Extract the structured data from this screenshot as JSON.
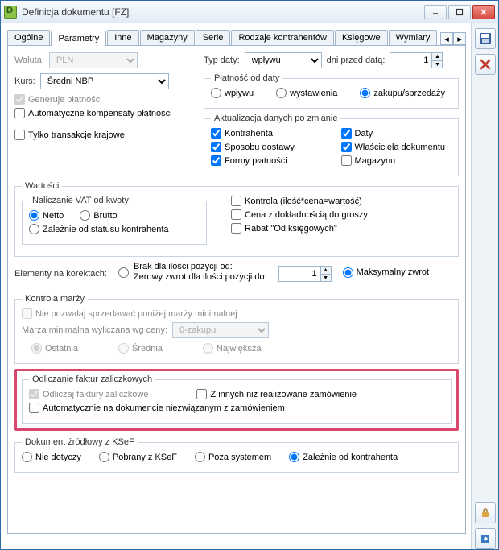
{
  "window": {
    "title": "Definicja dokumentu [FZ]"
  },
  "tabs": {
    "items": [
      {
        "label": "Ogólne"
      },
      {
        "label": "Parametry"
      },
      {
        "label": "Inne"
      },
      {
        "label": "Magazyny"
      },
      {
        "label": "Serie"
      },
      {
        "label": "Rodzaje kontrahentów"
      },
      {
        "label": "Księgowe"
      },
      {
        "label": "Wymiary"
      }
    ]
  },
  "left": {
    "waluta_label": "Waluta:",
    "waluta_value": "PLN",
    "kurs_label": "Kurs:",
    "kurs_value": "Średni NBP",
    "generuje_platnosci": "Generuje płatności",
    "auto_kompensaty": "Automatyczne kompensaty płatności",
    "tylko_krajowe": "Tylko transakcje krajowe"
  },
  "right": {
    "typ_daty_label": "Typ daty:",
    "typ_daty_value": "wpływu",
    "dni_przed_label": "dni przed datą:",
    "dni_przed_value": "1",
    "platnosc_od_daty_legend": "Płatność od daty",
    "pod_wplywu": "wpływu",
    "pod_wystawienia": "wystawienia",
    "pod_zakupu": "zakupu/sprzedaży",
    "aktualizacja_legend": "Aktualizacja danych po zmianie",
    "akt_kontrahenta": "Kontrahenta",
    "akt_daty": "Daty",
    "akt_sposobu": "Sposobu dostawy",
    "akt_wlasciciela": "Właściciela dokumentu",
    "akt_formy": "Formy płatności",
    "akt_magazynu": "Magazynu"
  },
  "wartosci": {
    "legend": "Wartości",
    "naliczanie_legend": "Naliczanie VAT od kwoty",
    "netto": "Netto",
    "brutto": "Brutto",
    "zaleznie": "Zależnie od statusu kontrahenta",
    "kontrola": "Kontrola (ilość*cena=wartość)",
    "cena_dokladnosc": "Cena z dokładnością do groszy",
    "rabat": "Rabat \"Od księgowych\""
  },
  "korekty": {
    "label": "Elementy na korektach:",
    "opt1a": "Brak dla ilości pozycji od:",
    "opt1b": "Zerowy zwrot dla ilości pozycji do:",
    "value": "1",
    "opt2": "Maksymalny zwrot"
  },
  "marza": {
    "legend": "Kontrola marży",
    "nie_pozwalaj": "Nie pozwalaj sprzedawać poniżej marży minimalnej",
    "min_label": "Marża minimalna wyliczana wg ceny:",
    "min_value": "0-zakupu",
    "ostatnia": "Ostatnia",
    "srednia": "Średnia",
    "najwieksza": "Największa"
  },
  "odliczanie": {
    "legend": "Odliczanie faktur zaliczkowych",
    "odliczaj": "Odliczaj faktury zaliczkowe",
    "zinnych": "Z innych niż realizowane zamówienie",
    "auto": "Automatycznie na dokumencie niezwiązanym z zamówieniem"
  },
  "ksef": {
    "legend": "Dokument źródłowy z KSeF",
    "nie_dotyczy": "Nie dotyczy",
    "pobrany": "Pobrany z KSeF",
    "poza": "Poza systemem",
    "zaleznie": "Zależnie od kontrahenta"
  }
}
